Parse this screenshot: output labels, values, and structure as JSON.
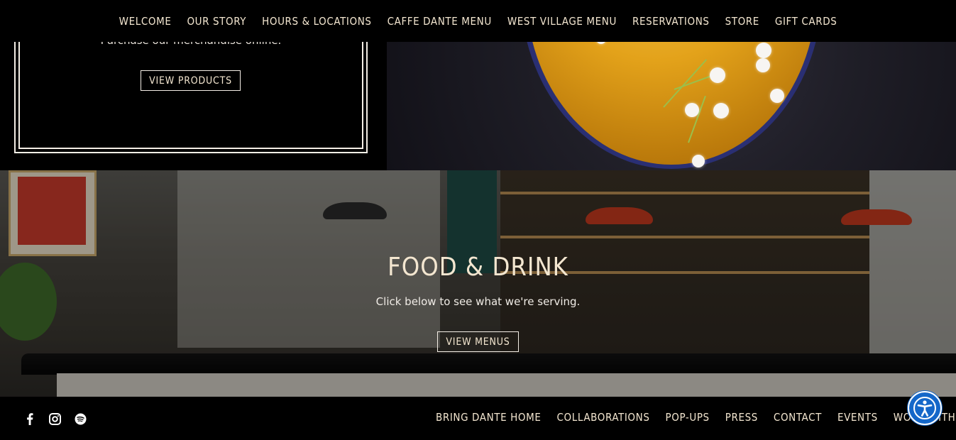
{
  "nav": {
    "items": [
      "Welcome",
      "Our Story",
      "Hours & Locations",
      "Caffe Dante Menu",
      "West Village Menu",
      "Reservations",
      "Store",
      "Gift Cards"
    ]
  },
  "store": {
    "text": "Purchase our merchandise online.",
    "button": "View Products"
  },
  "food": {
    "title": "Food & Drink",
    "subtitle": "Click below to see what we're serving.",
    "button": "View Menus"
  },
  "footer": {
    "social_icons": [
      "facebook-icon",
      "instagram-icon",
      "spotify-icon"
    ],
    "links": [
      "Bring Dante Home",
      "Collaborations",
      "Pop-Ups",
      "Press",
      "Contact",
      "Events",
      "Work With Us"
    ]
  },
  "accessibility": {
    "icon": "accessibility-icon",
    "color": "#1467c9"
  }
}
